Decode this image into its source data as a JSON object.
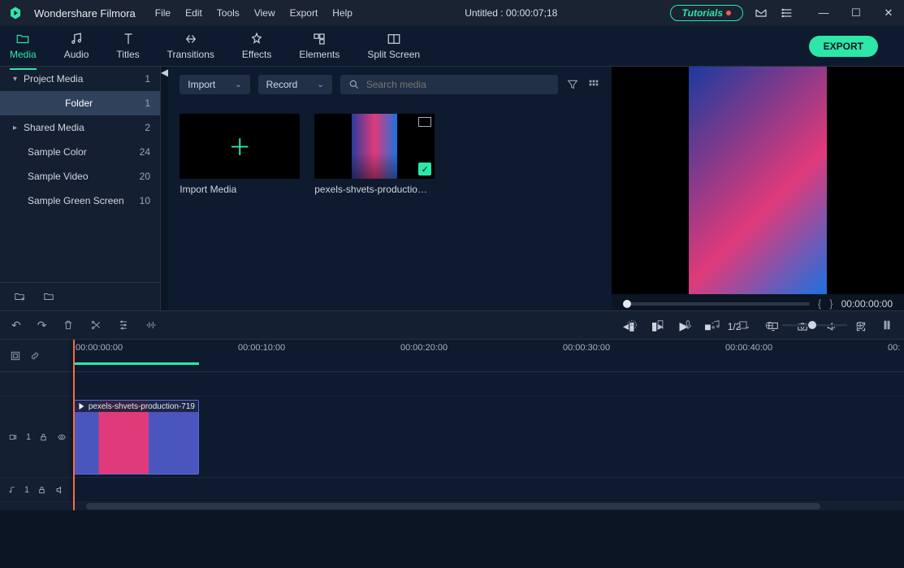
{
  "app": {
    "name": "Wondershare Filmora",
    "title": "Untitled : 00:00:07;18"
  },
  "menu": [
    "File",
    "Edit",
    "Tools",
    "View",
    "Export",
    "Help"
  ],
  "tutorials": "Tutorials",
  "tabs": [
    {
      "label": "Media",
      "icon": "folder-icon",
      "active": true
    },
    {
      "label": "Audio",
      "icon": "audio-icon"
    },
    {
      "label": "Titles",
      "icon": "titles-icon"
    },
    {
      "label": "Transitions",
      "icon": "transitions-icon"
    },
    {
      "label": "Effects",
      "icon": "effects-icon"
    },
    {
      "label": "Elements",
      "icon": "elements-icon"
    },
    {
      "label": "Split Screen",
      "icon": "splitscreen-icon"
    }
  ],
  "export_btn": "EXPORT",
  "library": [
    {
      "label": "Project Media",
      "count": 1,
      "expander": "▾"
    },
    {
      "label": "Folder",
      "count": 1,
      "selected": true
    },
    {
      "label": "Shared Media",
      "count": 2,
      "expander": "▸"
    },
    {
      "label": "Sample Color",
      "count": 24
    },
    {
      "label": "Sample Video",
      "count": 20
    },
    {
      "label": "Sample Green Screen",
      "count": 10
    }
  ],
  "browser": {
    "import_label": "Import",
    "record_label": "Record",
    "search_placeholder": "Search media",
    "cards": [
      {
        "kind": "import",
        "caption": "Import Media"
      },
      {
        "kind": "clip",
        "caption": "pexels-shvets-productio…"
      }
    ]
  },
  "preview": {
    "timecode": "00:00:00:00",
    "ratio": "1/2"
  },
  "ruler": {
    "ticks": [
      "00:00:00:00",
      "00:00:10:00",
      "00:00:20:00",
      "00:00:30:00",
      "00:00:40:00",
      "00:"
    ]
  },
  "clip": {
    "title": "pexels-shvets-production-719"
  },
  "track_labels": {
    "video": "1",
    "audio": "1"
  }
}
